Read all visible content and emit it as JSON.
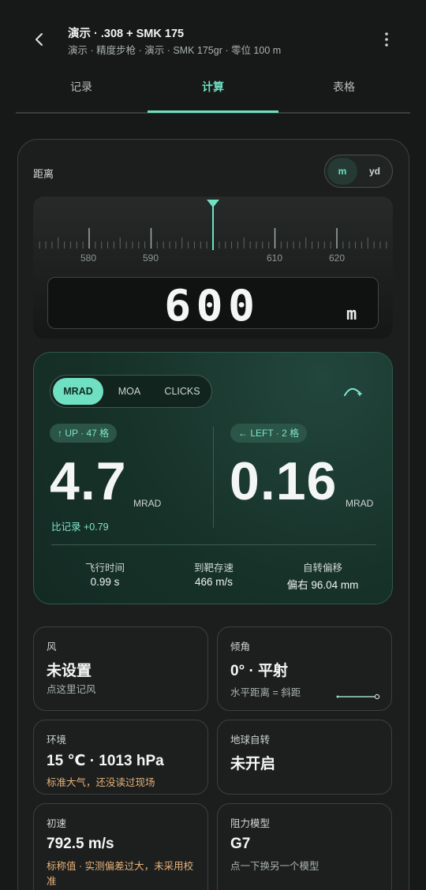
{
  "header": {
    "title": "演示 · .308 + SMK 175",
    "subtitle": "演示 · 精度步枪 · 演示 · SMK 175gr · 零位 100 m"
  },
  "tabs": [
    {
      "label": "记录"
    },
    {
      "label": "计算"
    },
    {
      "label": "表格"
    }
  ],
  "active_tab": "计算",
  "distance": {
    "label": "距离",
    "units": [
      "m",
      "yd"
    ],
    "active_unit": "m",
    "ruler_ticks": [
      "580",
      "590",
      "610",
      "620"
    ],
    "value": "600",
    "unit_display": "m"
  },
  "result": {
    "angle_units": [
      "MRAD",
      "MOA",
      "CLICKS"
    ],
    "active_angle_unit": "MRAD",
    "elevation": {
      "badge": "↑ UP · 47 格",
      "value": "4.7",
      "unit": "MRAD",
      "compare": "比记录 +0.79"
    },
    "windage": {
      "badge": "← LEFT · 2 格",
      "value": "0.16",
      "unit": "MRAD"
    },
    "stats": [
      {
        "label": "飞行时间",
        "value": "0.99 s"
      },
      {
        "label": "到靶存速",
        "value": "466 m/s"
      },
      {
        "label": "自转偏移",
        "value": "偏右 96.04 mm"
      }
    ]
  },
  "cards": {
    "wind": {
      "label": "风",
      "value": "未设置",
      "sub": "点这里记风"
    },
    "incline": {
      "label": "倾角",
      "value": "0° · 平射",
      "sub": "水平距离 = 斜距"
    },
    "env": {
      "label": "环境",
      "value": "15 ℃ · 1013 hPa",
      "sub": "标准大气，还没读过现场"
    },
    "coriolis": {
      "label": "地球自转",
      "value": "未开启"
    },
    "muzzle": {
      "label": "初速",
      "value": "792.5 m/s",
      "sub": "标称值 · 实测偏差过大，未采用校准"
    },
    "drag": {
      "label": "阻力模型",
      "value": "G7",
      "sub": "点一下换另一个模型"
    }
  },
  "colors": {
    "accent": "#6fe0c2",
    "background": "#171918",
    "result_card": "#173229",
    "warning_text": "#e7b27a"
  },
  "icons": [
    "back-arrow-icon",
    "more-vertical-icon",
    "trajectory-arc-icon",
    "slope-line-icon"
  ]
}
